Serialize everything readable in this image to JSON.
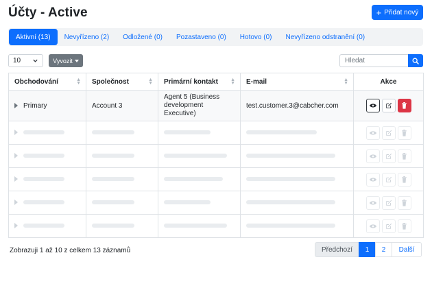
{
  "page": {
    "title": "Účty - Active"
  },
  "header": {
    "add_label": "Přidat nový"
  },
  "tabs": [
    {
      "label": "Aktivní (13)",
      "active": true
    },
    {
      "label": "Nevyřízeno (2)",
      "active": false
    },
    {
      "label": "Odložené (0)",
      "active": false
    },
    {
      "label": "Pozastaveno (0)",
      "active": false
    },
    {
      "label": "Hotovo (0)",
      "active": false
    },
    {
      "label": "Nevyřízeno odstranění (0)",
      "active": false
    }
  ],
  "toolbar": {
    "page_length": "10",
    "export_label": "Vyvozit",
    "search_placeholder": "Hledat",
    "search_value": ""
  },
  "table": {
    "columns": [
      "Obchodování",
      "Společnost",
      "Primární kontakt",
      "E-mail",
      "Akce"
    ],
    "rows": [
      {
        "obchodovani": "Primary",
        "spolecnost": "Account 3",
        "kontakt_lines": [
          "Agent 5 (Business",
          "development",
          "Executive)"
        ],
        "email": "test.customer.3@cabcher.com"
      }
    ],
    "placeholder_rows": 5
  },
  "footer": {
    "info": "Zobrazuji 1 až 10 z celkem 13 záznamů",
    "prev_label": "Předchozí",
    "pages": [
      "1",
      "2"
    ],
    "current_page": "1",
    "next_label": "Další"
  },
  "colors": {
    "primary": "#0d6efd",
    "danger": "#dc3545",
    "secondary": "#6c757d"
  }
}
